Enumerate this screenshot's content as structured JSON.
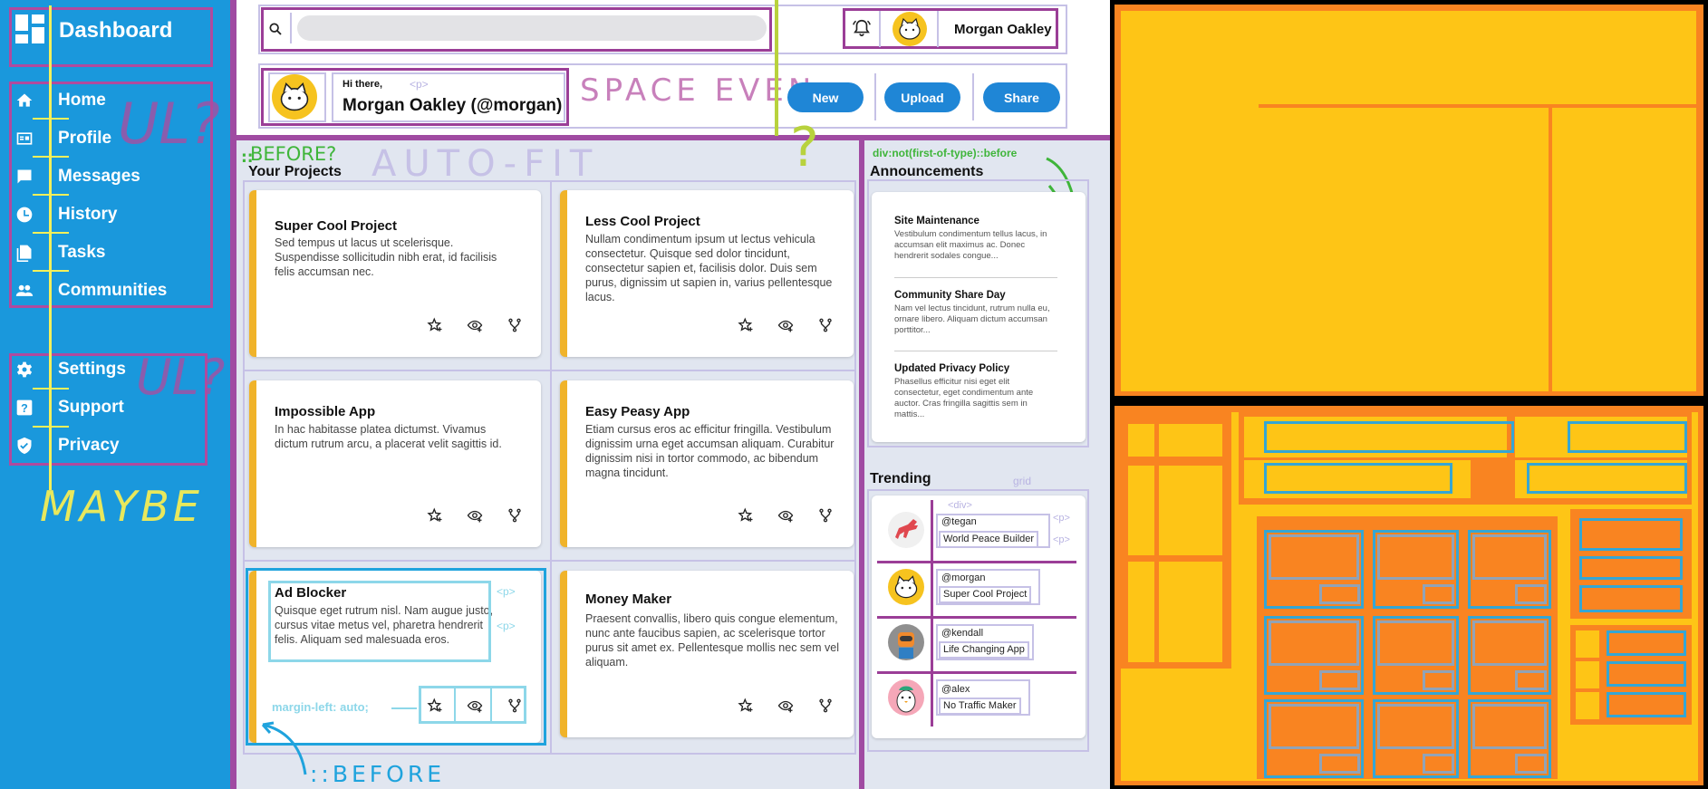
{
  "sidebar": {
    "title": "Dashboard",
    "primary_items": [
      {
        "label": "Home",
        "icon": "home-icon"
      },
      {
        "label": "Profile",
        "icon": "id-card-icon"
      },
      {
        "label": "Messages",
        "icon": "chat-icon"
      },
      {
        "label": "History",
        "icon": "clock-icon"
      },
      {
        "label": "Tasks",
        "icon": "documents-icon"
      },
      {
        "label": "Communities",
        "icon": "people-icon"
      }
    ],
    "secondary_items": [
      {
        "label": "Settings",
        "icon": "gear-icon"
      },
      {
        "label": "Support",
        "icon": "help-icon"
      },
      {
        "label": "Privacy",
        "icon": "shield-icon"
      }
    ],
    "annotations": {
      "ul_1": "UL?",
      "ul_2": "UL?",
      "maybe": "MAYBE"
    }
  },
  "header": {
    "search": {
      "placeholder": ""
    },
    "user_name": "Morgan Oakley"
  },
  "hero": {
    "greeting": "Hi there,",
    "display_name": "Morgan Oakley (@morgan)",
    "buttons": [
      "New",
      "Upload",
      "Share"
    ],
    "annotations": {
      "p_tag": "<p>",
      "space_even": "SPACE EVEN",
      "question": "?"
    }
  },
  "projects": {
    "heading": "Your Projects",
    "annotations": {
      "before": "BEFORE?",
      "before_prefix": "::",
      "auto_fit": "AUTO-FIT",
      "p1": "<p>",
      "p2": "<p>",
      "margin_left": "margin-left: auto;",
      "before_bottom": "::BEFORE"
    },
    "cards": [
      {
        "title": "Super Cool Project",
        "text": "Sed tempus ut lacus ut scelerisque. Suspendisse sollicitudin nibh erat, id facilisis felis accumsan nec."
      },
      {
        "title": "Less Cool Project",
        "text": "Nullam condimentum ipsum ut lectus vehicula consectetur. Quisque sed dolor tincidunt, consectetur sapien et, facilisis dolor. Duis sem purus, dignissim ut sapien in, varius pellentesque lacus."
      },
      {
        "title": "Impossible App",
        "text": "In hac habitasse platea dictumst. Vivamus dictum rutrum arcu, a placerat velit sagittis id."
      },
      {
        "title": "Easy Peasy App",
        "text": "Etiam cursus eros ac efficitur fringilla. Vestibulum dignissim urna eget accumsan aliquam. Curabitur dignissim nisi in tortor commodo, ac bibendum magna tincidunt."
      },
      {
        "title": "Ad Blocker",
        "text": "Quisque eget rutrum nisl. Nam augue justo, cursus vitae metus vel, pharetra hendrerit felis. Aliquam sed malesuada eros."
      },
      {
        "title": "Money Maker",
        "text": "Praesent convallis, libero quis congue elementum, nunc ante faucibus sapien, ac scelerisque tortor purus sit amet ex. Pellentesque mollis nec sem vel aliquam."
      }
    ]
  },
  "announcements": {
    "heading": "Announcements",
    "annotation": "div:not(first-of-type)::before",
    "items": [
      {
        "title": "Site Maintenance",
        "text": "Vestibulum condimentum tellus lacus, in accumsan elit maximus ac. Donec hendrerit sodales congue..."
      },
      {
        "title": "Community Share Day",
        "text": "Nam vel lectus tincidunt, rutrum nulla eu, ornare libero. Aliquam dictum accumsan porttitor..."
      },
      {
        "title": "Updated Privacy Policy",
        "text": "Phasellus efficitur nisi eget elit consectetur, eget condimentum ante auctor. Cras fringilla sagittis sem in mattis..."
      }
    ]
  },
  "trending": {
    "heading": "Trending",
    "annotations": {
      "grid": "grid",
      "div": "<div>",
      "p1": "<p>",
      "p2": "<p>"
    },
    "items": [
      {
        "handle": "@tegan",
        "project": "World Peace Builder",
        "avatar": "dog-avatar"
      },
      {
        "handle": "@morgan",
        "project": "Super Cool Project",
        "avatar": "cat-avatar"
      },
      {
        "handle": "@kendall",
        "project": "Life Changing App",
        "avatar": "robot-avatar"
      },
      {
        "handle": "@alex",
        "project": "No Traffic Maker",
        "avatar": "penguin-avatar"
      }
    ]
  },
  "colors": {
    "sidebar": "#1a98dc",
    "accent_button": "#1f86d6",
    "card_stripe": "#f0b32a",
    "layout_purple": "#a04ba2",
    "block_orange": "#f98421",
    "block_yellow": "#fec516",
    "block_blue": "#35a6d4"
  }
}
